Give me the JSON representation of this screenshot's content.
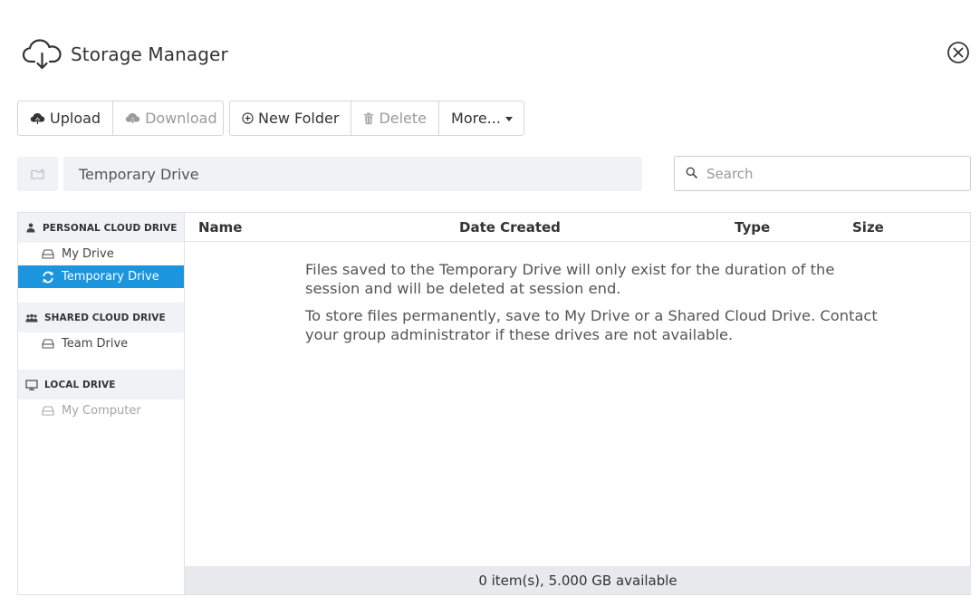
{
  "app": {
    "title": "Storage Manager"
  },
  "toolbar": {
    "upload_label": "Upload",
    "download_label": "Download",
    "new_folder_label": "New Folder",
    "delete_label": "Delete",
    "more_label": "More..."
  },
  "path": {
    "current": "Temporary Drive"
  },
  "search": {
    "placeholder": "Search",
    "value": ""
  },
  "sidebar": {
    "personal": {
      "heading": "PERSONAL CLOUD DRIVE",
      "items": [
        {
          "label": "My Drive"
        },
        {
          "label": "Temporary Drive",
          "selected": true
        }
      ]
    },
    "shared": {
      "heading": "SHARED CLOUD DRIVE",
      "items": [
        {
          "label": "Team Drive"
        }
      ]
    },
    "local": {
      "heading": "LOCAL DRIVE",
      "items": [
        {
          "label": "My Computer",
          "disabled": true
        }
      ]
    }
  },
  "table": {
    "columns": [
      "Name",
      "Date Created",
      "Type",
      "Size"
    ]
  },
  "message": {
    "line1": "Files saved to the Temporary Drive will only exist for the duration of the session and will be deleted at session end.",
    "line2": "To store files permanently, save to My Drive or a Shared Cloud Drive. Contact your group administrator if these drives are not available."
  },
  "status": {
    "text": "0 item(s), 5.000 GB available"
  },
  "colors": {
    "accent": "#1a95de",
    "panel_bg": "#f0f2f6",
    "status_bg": "#e8e9ed"
  },
  "icons": {
    "app": "cloud-download-icon",
    "close": "close-circle-icon",
    "upload": "cloud-upload-icon",
    "download": "cloud-download-icon",
    "new_folder": "plus-circle-icon",
    "delete": "trash-icon",
    "up": "folder-up-icon",
    "search": "search-icon",
    "personal": "user-icon",
    "shared": "users-icon",
    "local": "monitor-icon",
    "drive": "drive-icon",
    "sync": "sync-icon"
  }
}
